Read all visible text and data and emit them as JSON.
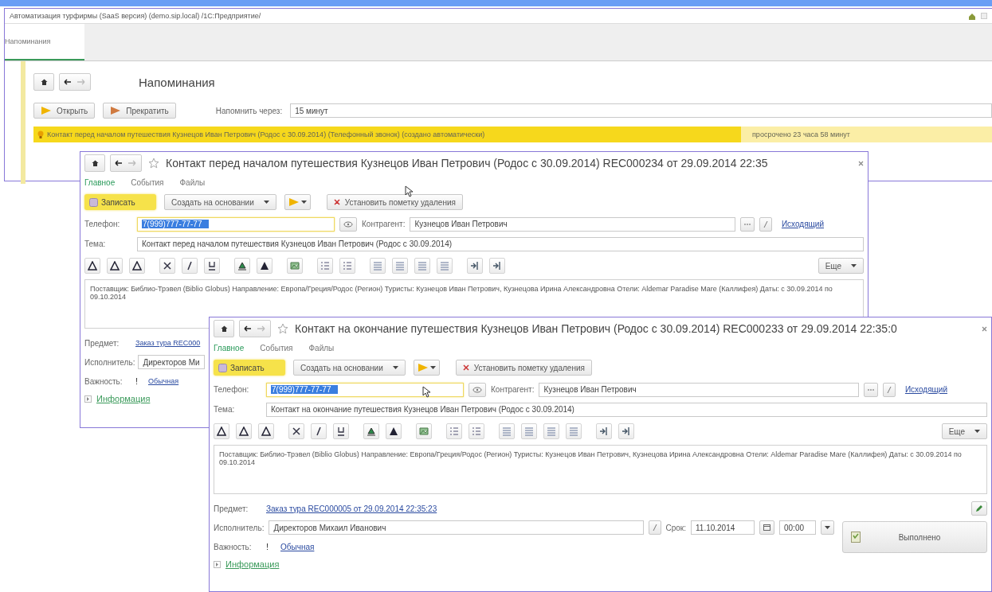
{
  "main_window": {
    "title": "Автоматизация турфирмы (SaaS версия) (demo.sip.local) /1С:Предприятие/",
    "tabs": [
      {
        "label": "Напоминания",
        "selected": true
      }
    ],
    "heading": "Напоминания",
    "buttons": [
      "Открыть",
      "Прекратить"
    ],
    "remind_label": "Напомнить через:",
    "remind_value": "15 минут",
    "reminders": [
      {
        "text": "Контакт перед началом путешествия Кузнецов Иван Петрович (Родос с 30.09.2014) (Телефонный звонок) (создано автоматически)",
        "overdue": "просрочено 23 часа 58 минут",
        "selected": true
      }
    ]
  },
  "windows": [
    {
      "title": "Контакт перед началом путешествия Кузнецов Иван Петрович (Родос с 30.09.2014) REC000234 от 29.09.2014 22:35",
      "tabs": [
        {
          "label": "Главное",
          "selected": true
        },
        {
          "label": "События",
          "selected": false
        },
        {
          "label": "Файлы",
          "selected": false
        }
      ],
      "save": "Записать",
      "create_based": "Создать на основании",
      "delete_mark": "Установить пометку удаления",
      "phone_label": "Телефон:",
      "phone": "7(999)777-77-77",
      "counterparty_label": "Контрагент:",
      "counterparty": "Кузнецов Иван Петрович",
      "direction": "Исходящий",
      "topic_label": "Тема:",
      "topic": "Контакт перед началом путешествия Кузнецов Иван Петрович (Родос с 30.09.2014)",
      "more": "Еще",
      "body": "Поставщик: Библио-Трэвел (Biblio Globus) Направление: Европа/Греция/Родос (Регион) Туристы: Кузнецов Иван Петрович, Кузнецова Ирина Александровна Отели: Aldemar Paradise Mare (Каллифея) Даты: с 30.09.2014 по 09.10.2014",
      "subject_label": "Предмет:",
      "subject": "Заказ тура REC000",
      "executor_label": "Исполнитель:",
      "executor": "Директоров Ми",
      "importance_label": "Важность:",
      "importance_mark": "!",
      "importance": "Обычная",
      "info": "Информация"
    },
    {
      "title": "Контакт на окончание путешествия Кузнецов Иван Петрович (Родос с 30.09.2014) REC000233 от 29.09.2014 22:35:0",
      "tabs": [
        {
          "label": "Главное",
          "selected": true
        },
        {
          "label": "События",
          "selected": false
        },
        {
          "label": "Файлы",
          "selected": false
        }
      ],
      "save": "Записать",
      "create_based": "Создать на основании",
      "delete_mark": "Установить пометку удаления",
      "phone_label": "Телефон:",
      "phone": "7(999)777-77-77",
      "counterparty_label": "Контрагент:",
      "counterparty": "Кузнецов Иван Петрович",
      "direction": "Исходящий",
      "topic_label": "Тема:",
      "topic": "Контакт на окончание путешествия Кузнецов Иван Петрович (Родос с 30.09.2014)",
      "more": "Еще",
      "body": "Поставщик: Библио-Трэвел (Biblio Globus) Направление: Европа/Греция/Родос (Регион) Туристы: Кузнецов Иван Петрович, Кузнецова Ирина Александровна Отели: Aldemar Paradise Mare (Каллифея) Даты: с 30.09.2014 по 09.10.2014",
      "subject_label": "Предмет:",
      "subject": "Заказ тура REC000005 от 29.09.2014 22:35:23",
      "executor_label": "Исполнитель:",
      "executor": "Директоров Михаил Иванович",
      "due_label": "Срок:",
      "due_date": "11.10.2014",
      "due_time": "00:00",
      "done": "Выполнено",
      "importance_label": "Важность:",
      "importance_mark": "!",
      "importance": "Обычная",
      "info": "Информация"
    }
  ]
}
